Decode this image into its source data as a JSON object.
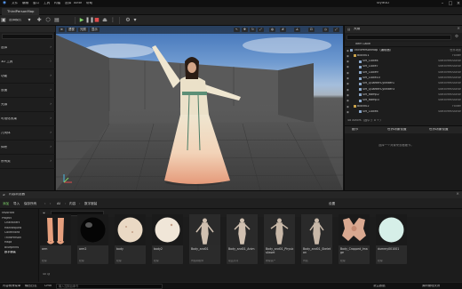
{
  "menu": {
    "items": [
      "文件",
      "编辑",
      "窗口",
      "工具",
      "构建",
      "选择",
      "Actor",
      "帮助"
    ],
    "brand": "Style3D"
  },
  "tabs": {
    "level": "ThirdPersonMap"
  },
  "toolbar": {
    "mode": "选择模式"
  },
  "left_panel": {
    "rows": [
      "选择",
      "3D 工具",
      "功能",
      "放置",
      "光源",
      "可视化效果",
      "几何体",
      "体积",
      "所有类"
    ]
  },
  "viewport": {
    "buttons": [
      "透视",
      "光照",
      "显示"
    ]
  },
  "outliner": {
    "title": "大纲",
    "column_label": "Item Label",
    "rows": [
      {
        "label": "ThirdPersonMap（编辑器）",
        "type": "世界场景"
      },
      {
        "label": "Block01",
        "type": "Folder"
      },
      {
        "label": "SM_Cube4",
        "type": "StaticMeshActor"
      },
      {
        "label": "SM_Cube7",
        "type": "StaticMeshActor"
      },
      {
        "label": "SM_Cube9",
        "type": "StaticMeshActor"
      },
      {
        "label": "SM_Cube10",
        "type": "StaticMeshActor"
      },
      {
        "label": "SM_QuarterCylinder1",
        "type": "StaticMeshActor"
      },
      {
        "label": "SM_QuarterCylinder3",
        "type": "StaticMeshActor"
      },
      {
        "label": "SM_Ramp2",
        "type": "StaticMeshActor"
      },
      {
        "label": "SM_Ramp3",
        "type": "StaticMeshActor"
      },
      {
        "label": "Block02",
        "type": "Folder"
      },
      {
        "label": "SM_Cube4",
        "type": "StaticMeshActor"
      }
    ],
    "footer": "48 Actors（选中了 0 个）"
  },
  "details": {
    "tabs": [
      "细节",
      "世界场景设置",
      "世界场景设置"
    ],
    "empty_text": "选择一个对象来查看细节。"
  },
  "content_browser": {
    "tab_label": "内容浏览器",
    "toolbar": [
      "添加",
      "导入",
      "保存所有"
    ],
    "path": [
      "All",
      "内容",
      "数字服装"
    ],
    "settings": "设置",
    "tree": [
      "Favorites",
      "Project",
      "Characters",
      "Mannequins",
      "Collections",
      "ThirdPerson",
      "Maps",
      "Blueprints",
      "数字服装"
    ],
    "assets": [
      {
        "name": "arm",
        "type": "纹理"
      },
      {
        "name": "arm2",
        "type": "纹理"
      },
      {
        "name": "body",
        "type": "纹理"
      },
      {
        "name": "body2",
        "type": "纹理"
      },
      {
        "name": "Body_and01",
        "type": "骨骼网格体"
      },
      {
        "name": "Body_and01_Anim",
        "type": "动画序列"
      },
      {
        "name": "Body_and01_PhysicsAsset",
        "type": "物理资产"
      },
      {
        "name": "Body_and01_Skeleton",
        "type": "骨骼"
      },
      {
        "name": "Body_Cropped_Image",
        "type": "纹理"
      },
      {
        "name": "dummy001001",
        "type": "纹理"
      }
    ],
    "count": "40 项"
  },
  "statusbar": {
    "drawer": "内容侧滑菜单",
    "log": "输出日志",
    "cmd": "Cmd",
    "cmd_placeholder": "输入控制台命令",
    "derived": "派生数据",
    "source": "源码管理关闭"
  },
  "colors": {
    "accent": "#0f72d6",
    "play": "#7fd46a",
    "stop": "#e04b4b"
  }
}
